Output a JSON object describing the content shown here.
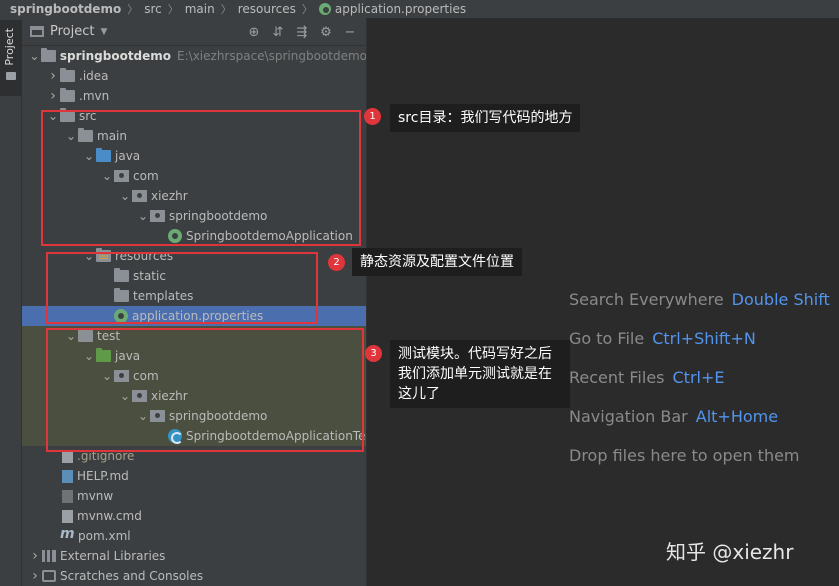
{
  "breadcrumb": [
    "springbootdemo",
    "src",
    "main",
    "resources",
    "application.properties"
  ],
  "side_tab": "Project",
  "panel": {
    "title": "Project",
    "tools": [
      "locate-icon",
      "expand-all-icon",
      "collapse-all-icon",
      "gear-icon",
      "hide-icon"
    ]
  },
  "tree": [
    {
      "label": "springbootdemo",
      "path": "E:\\xiezhrspace\\springbootdemo",
      "depth": 0,
      "arrow": "down",
      "icon": "folder",
      "bold": true
    },
    {
      "label": ".idea",
      "depth": 1,
      "arrow": "right",
      "icon": "folder"
    },
    {
      "label": ".mvn",
      "depth": 1,
      "arrow": "right",
      "icon": "folder"
    },
    {
      "label": "src",
      "depth": 1,
      "arrow": "down",
      "icon": "folder"
    },
    {
      "label": "main",
      "depth": 2,
      "arrow": "down",
      "icon": "folder"
    },
    {
      "label": "java",
      "depth": 3,
      "arrow": "down",
      "icon": "folder-blue"
    },
    {
      "label": "com",
      "depth": 4,
      "arrow": "down",
      "icon": "package"
    },
    {
      "label": "xiezhr",
      "depth": 5,
      "arrow": "down",
      "icon": "package"
    },
    {
      "label": "springbootdemo",
      "depth": 6,
      "arrow": "down",
      "icon": "package"
    },
    {
      "label": "SpringbootdemoApplication",
      "depth": 7,
      "arrow": "none",
      "icon": "spring-class"
    },
    {
      "label": "resources",
      "depth": 3,
      "arrow": "down",
      "icon": "folder-resources"
    },
    {
      "label": "static",
      "depth": 4,
      "arrow": "none",
      "icon": "folder"
    },
    {
      "label": "templates",
      "depth": 4,
      "arrow": "none",
      "icon": "folder"
    },
    {
      "label": "application.properties",
      "depth": 4,
      "arrow": "none",
      "icon": "spring-config",
      "selected": true
    },
    {
      "label": "test",
      "depth": 2,
      "arrow": "down",
      "icon": "folder",
      "test": true
    },
    {
      "label": "java",
      "depth": 3,
      "arrow": "down",
      "icon": "folder-green",
      "test": true
    },
    {
      "label": "com",
      "depth": 4,
      "arrow": "down",
      "icon": "package",
      "test": true
    },
    {
      "label": "xiezhr",
      "depth": 5,
      "arrow": "down",
      "icon": "package",
      "test": true
    },
    {
      "label": "springbootdemo",
      "depth": 6,
      "arrow": "down",
      "icon": "package",
      "test": true
    },
    {
      "label": "SpringbootdemoApplicationTe",
      "depth": 7,
      "arrow": "none",
      "icon": "java-class",
      "test": true
    },
    {
      "label": ".gitignore",
      "depth": 1,
      "arrow": "none",
      "icon": "file",
      "gitignore": true
    },
    {
      "label": "HELP.md",
      "depth": 1,
      "arrow": "none",
      "icon": "file-md"
    },
    {
      "label": "mvnw",
      "depth": 1,
      "arrow": "none",
      "icon": "file-sh"
    },
    {
      "label": "mvnw.cmd",
      "depth": 1,
      "arrow": "none",
      "icon": "file"
    },
    {
      "label": "pom.xml",
      "depth": 1,
      "arrow": "none",
      "icon": "pom"
    },
    {
      "label": "External Libraries",
      "depth": 0,
      "arrow": "right",
      "icon": "libraries"
    },
    {
      "label": "Scratches and Consoles",
      "depth": 0,
      "arrow": "right",
      "icon": "scratches"
    }
  ],
  "annotations": [
    {
      "number": "1",
      "text": "src目录：我们写代码的地方"
    },
    {
      "number": "2",
      "text": "静态资源及配置文件位置"
    },
    {
      "number": "3",
      "text": "测试模块。代码写好之后我们添加单元测试就是在这儿了"
    }
  ],
  "hints": [
    {
      "text": "Search Everywhere",
      "key": "Double Shift"
    },
    {
      "text": "Go to File",
      "key": "Ctrl+Shift+N"
    },
    {
      "text": "Recent Files",
      "key": "Ctrl+E"
    },
    {
      "text": "Navigation Bar",
      "key": "Alt+Home"
    },
    {
      "text": "Drop files here to open them",
      "key": ""
    }
  ],
  "watermark": "知乎 @xiezhr",
  "colors": {
    "accent": "#5394ec",
    "annotation": "#e0353b",
    "selection": "#4b6eaf"
  }
}
